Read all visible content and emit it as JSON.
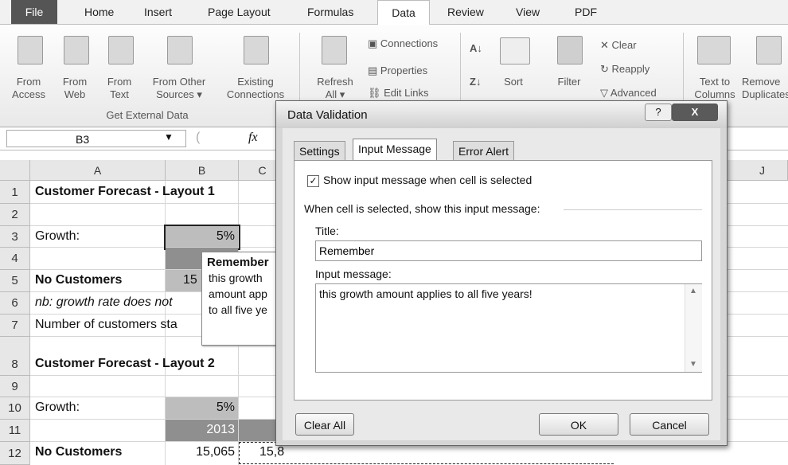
{
  "ribbon": {
    "tabs": [
      "File",
      "Home",
      "Insert",
      "Page Layout",
      "Formulas",
      "Data",
      "Review",
      "View",
      "PDF"
    ],
    "get_external_data": {
      "from_access": [
        "From",
        "Access"
      ],
      "from_web": [
        "From",
        "Web"
      ],
      "from_text": [
        "From",
        "Text"
      ],
      "from_other": [
        "From Other",
        "Sources ▾"
      ],
      "existing": [
        "Existing",
        "Connections"
      ],
      "group_label": "Get External Data"
    },
    "refresh": [
      "Refresh",
      "All ▾"
    ],
    "connections": "Connections",
    "properties": "Properties",
    "edit_links": "Edit Links",
    "sort_label": "Sort",
    "filter_label": "Filter",
    "clear_label": "Clear",
    "reapply_label": "Reapply",
    "advanced_label": "Advanced",
    "text_to_columns": [
      "Text to",
      "Columns"
    ],
    "remove_duplicates": [
      "Remove",
      "Duplicates"
    ]
  },
  "formula_bar": {
    "cell_ref": "B3",
    "fx": "fx"
  },
  "grid": {
    "columns": [
      "A",
      "B",
      "C",
      "J"
    ],
    "rows": [
      "1",
      "2",
      "3",
      "4",
      "5",
      "6",
      "7",
      "8",
      "9",
      "10",
      "11",
      "12"
    ],
    "cells": {
      "a1": "Customer Forecast - Layout 1",
      "a3": "Growth:",
      "b3": "5%",
      "a5": "No Customers",
      "b5": "15",
      "a6": "nb: growth rate does not",
      "a7": "Number of customers sta",
      "a8": "Customer Forecast - Layout 2",
      "a10": "Growth:",
      "b10": "5%",
      "b11": "2013",
      "a12": "No Customers",
      "b12": "15,065",
      "c12": "15,8"
    }
  },
  "tooltip": {
    "title": "Remember",
    "lines": [
      "this growth",
      "amount app",
      "to all five ye"
    ]
  },
  "dialog": {
    "title": "Data Validation",
    "tabs": [
      "Settings",
      "Input Message",
      "Error Alert"
    ],
    "show_message_checkbox": "Show input message when cell is selected",
    "section_label": "When cell is selected, show this input message:",
    "title_label": "Title:",
    "title_value": "Remember",
    "message_label": "Input message:",
    "message_value": "this growth amount applies to all five years!",
    "clear_all": "Clear All",
    "ok": "OK",
    "cancel": "Cancel",
    "help": "?",
    "close": "X"
  }
}
